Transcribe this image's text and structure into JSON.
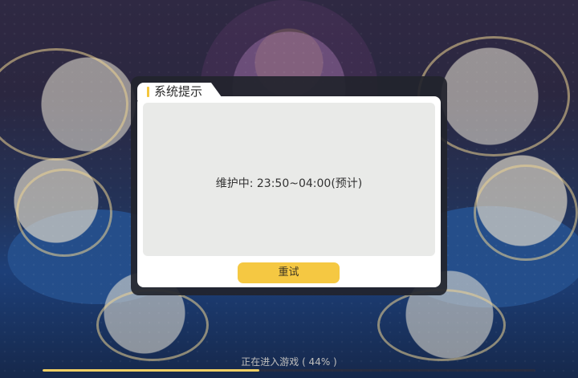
{
  "dialog": {
    "title": "系统提示",
    "message": "维护中: 23:50~04:00(预计)",
    "retry_label": "重试"
  },
  "loading": {
    "text": "正在进入游戏 ( 44% )",
    "progress": 0.44
  },
  "colors": {
    "accent": "#f5c842",
    "dialog_frame": "#22242d",
    "dialog_panel": "#e9eae8"
  }
}
